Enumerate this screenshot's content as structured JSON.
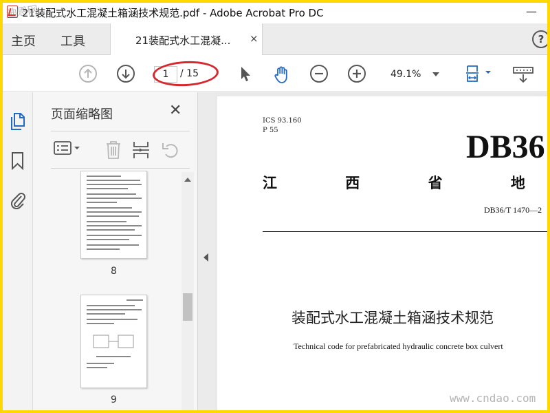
{
  "window": {
    "title": "21装配式水工混凝土箱涵技术规范.pdf - Adobe Acrobat Pro DC",
    "minimize": "—"
  },
  "tabs": {
    "home": "主页",
    "tools": "工具",
    "document": "21装配式水工混凝...",
    "close": "×",
    "help": "?"
  },
  "toolbar": {
    "current_page": "1",
    "total_pages": "/ 15",
    "zoom": "49.1%",
    "icons": [
      "prev-page-icon",
      "next-page-icon",
      "select-cursor-icon",
      "hand-tool-icon",
      "zoom-out-icon",
      "zoom-in-icon",
      "page-fit-icon",
      "scroll-mode-icon"
    ]
  },
  "sidebar": {
    "panel_title": "页面缩略图",
    "close": "✕",
    "thumbnails": [
      {
        "page_label": "8"
      },
      {
        "page_label": "9"
      }
    ]
  },
  "document": {
    "ics": "ICS 93.160",
    "category": "P 55",
    "header_code": "DB36",
    "region_label": "江 西 省 地 方 标",
    "standard_number": "DB36/T 1470—2",
    "title_cn": "装配式水工混凝土箱涵技术规范",
    "title_en": "Technical code for prefabricated hydraulic concrete box culvert"
  },
  "watermark": {
    "top_left": "迪恩网",
    "bottom_right": "www.cndao.com"
  },
  "colors": {
    "frame": "#ffd800",
    "annotation": "#d6262e",
    "accent_blue": "#2268c5"
  }
}
